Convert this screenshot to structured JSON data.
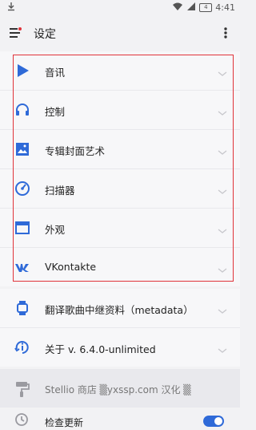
{
  "status_bar": {
    "left_icon": "download-arrow-icon",
    "battery_level": "4",
    "time": "4:41"
  },
  "app_bar": {
    "title": "设定",
    "menu_icon": "hamburger-icon",
    "more_icon": "more-vertical-icon"
  },
  "settings_items": [
    {
      "label": "音讯",
      "icon": "play-icon"
    },
    {
      "label": "控制",
      "icon": "headphones-icon"
    },
    {
      "label": "专辑封面艺术",
      "icon": "image-icon"
    },
    {
      "label": "扫描器",
      "icon": "scanner-icon"
    },
    {
      "label": "外观",
      "icon": "window-icon"
    },
    {
      "label": "VKontakte",
      "icon": "vk-icon"
    },
    {
      "label": "翻译歌曲中继资料（metadata）",
      "icon": "watch-icon"
    },
    {
      "label": "关于 v. 6.4.0-unlimited",
      "icon": "info-icon"
    }
  ],
  "promo": {
    "label": "Stellio 商店 ▒yxssp.com 汉化 ▒",
    "icon": "paint-roller-icon"
  },
  "check_update": {
    "label": "检查更新",
    "enabled": true
  },
  "colors": {
    "accent_blue": "#2f6ad8",
    "highlight_red": "#e0333a"
  }
}
